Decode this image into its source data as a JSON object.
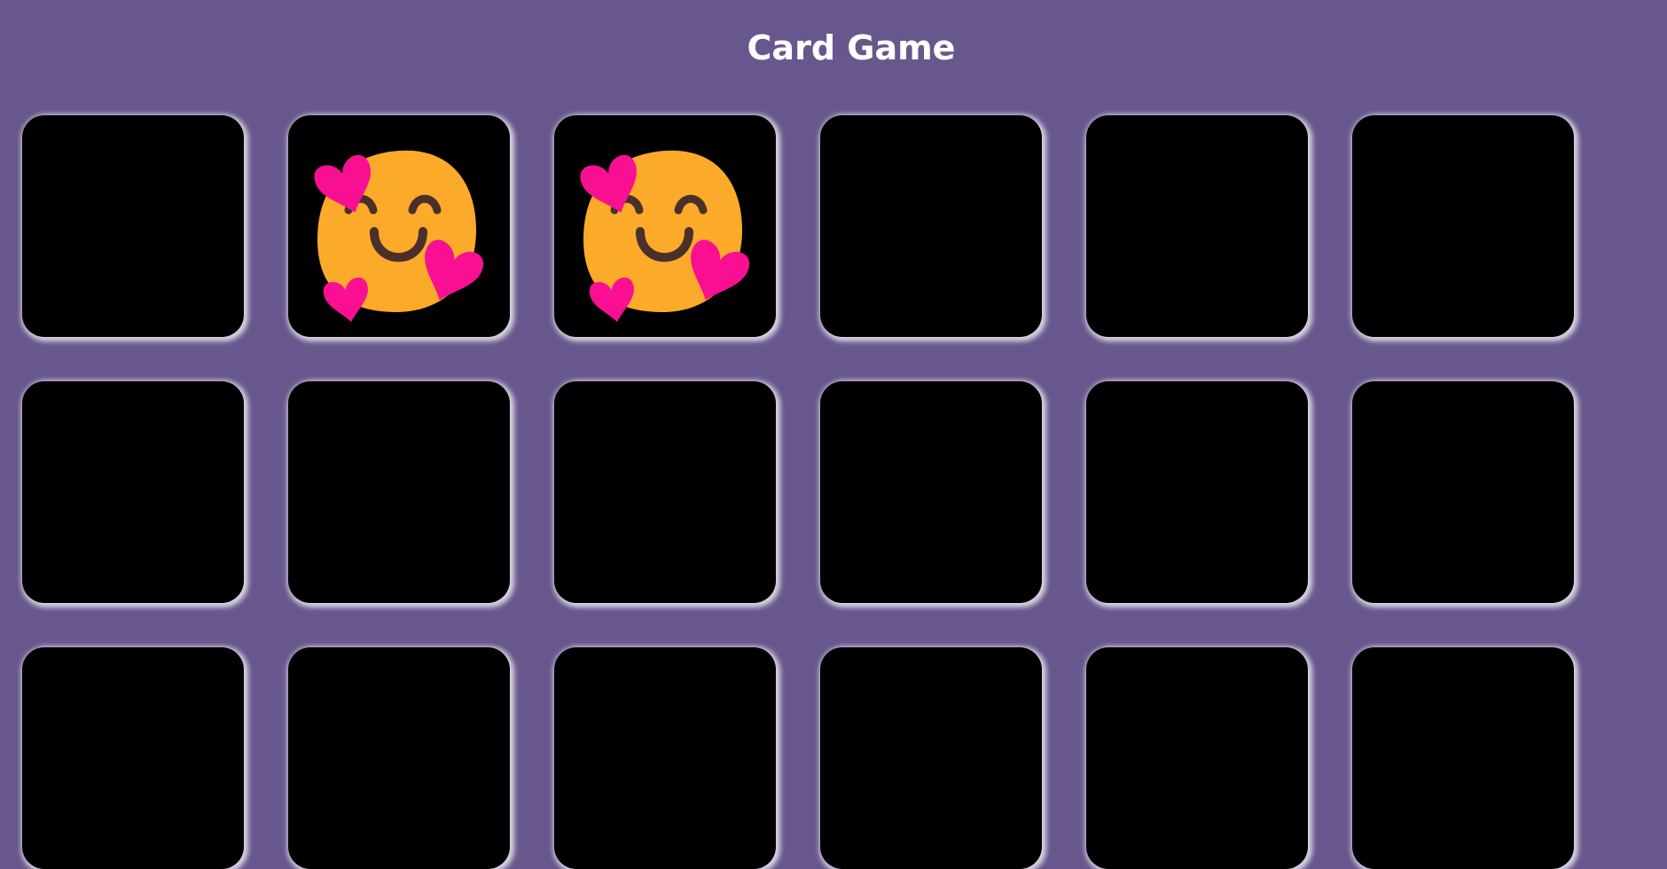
{
  "header": {
    "title": "Card Game"
  },
  "board": {
    "columns": 6,
    "cards": [
      {
        "face": "hidden"
      },
      {
        "face": "smiling-face-with-hearts"
      },
      {
        "face": "smiling-face-with-hearts"
      },
      {
        "face": "hidden"
      },
      {
        "face": "hidden"
      },
      {
        "face": "hidden"
      },
      {
        "face": "hidden"
      },
      {
        "face": "hidden"
      },
      {
        "face": "hidden"
      },
      {
        "face": "hidden"
      },
      {
        "face": "hidden"
      },
      {
        "face": "hidden"
      },
      {
        "face": "hidden"
      },
      {
        "face": "hidden"
      },
      {
        "face": "hidden"
      },
      {
        "face": "hidden"
      },
      {
        "face": "hidden"
      },
      {
        "face": "hidden"
      }
    ]
  },
  "colors": {
    "background": "#68578c",
    "card_back": "#000000",
    "title": "#ffffff",
    "face_yellow": "#fbaa2a",
    "heart_pink": "#f90f92",
    "feature_dark": "#4a2f2b"
  }
}
